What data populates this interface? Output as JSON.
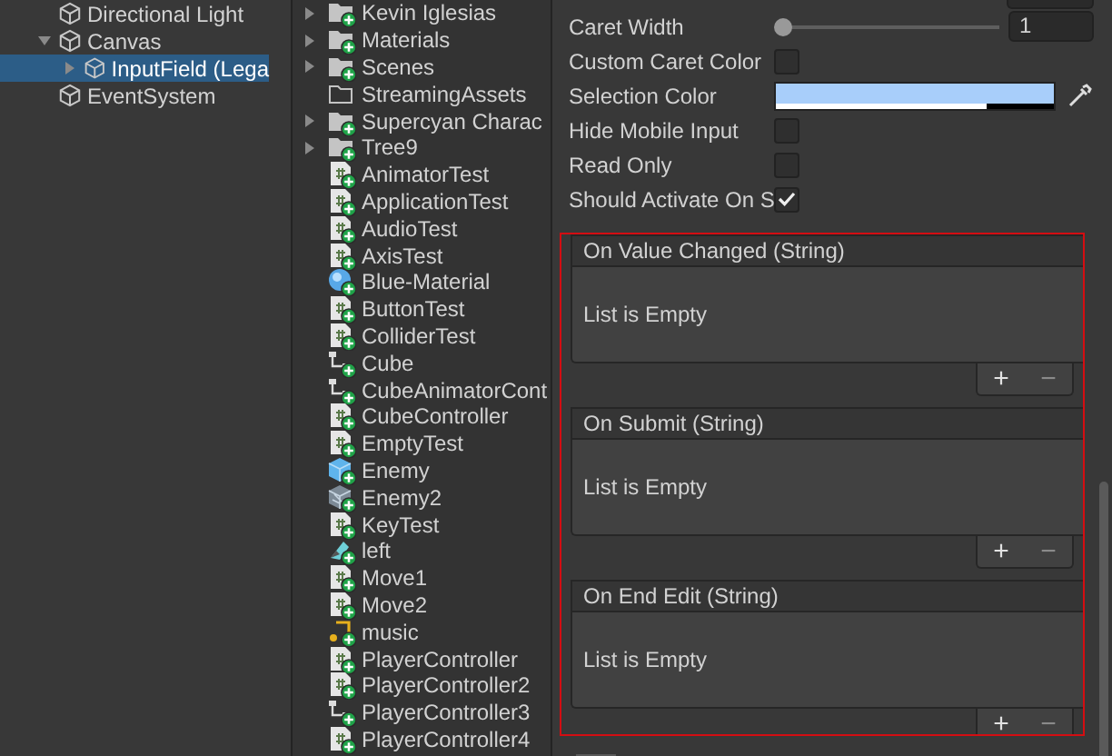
{
  "hierarchy": {
    "items": [
      {
        "label": "Directional Light",
        "selected": false
      },
      {
        "label": "Canvas",
        "selected": false,
        "expanded": true,
        "children": [
          {
            "label": "InputField (Lega",
            "selected": true,
            "expanded": false
          }
        ]
      },
      {
        "label": "EventSystem",
        "selected": false
      }
    ]
  },
  "project": {
    "items": [
      {
        "label": "Kevin Iglesias",
        "kind": "folder",
        "expanded": false,
        "added": true
      },
      {
        "label": "Materials",
        "kind": "folder",
        "expanded": false,
        "added": true
      },
      {
        "label": "Scenes",
        "kind": "folder",
        "expanded": false,
        "added": true
      },
      {
        "label": "StreamingAssets",
        "kind": "empty-folder",
        "added": false
      },
      {
        "label": "Supercyan Charac",
        "kind": "folder",
        "expanded": false,
        "added": true
      },
      {
        "label": "Tree9",
        "kind": "folder",
        "expanded": false,
        "added": true
      },
      {
        "label": "AnimatorTest",
        "kind": "script",
        "added": true
      },
      {
        "label": "ApplicationTest",
        "kind": "script",
        "added": true
      },
      {
        "label": "AudioTest",
        "kind": "script",
        "added": true
      },
      {
        "label": "AxisTest",
        "kind": "script",
        "added": true
      },
      {
        "label": "Blue-Material",
        "kind": "material",
        "added": true
      },
      {
        "label": "ButtonTest",
        "kind": "script",
        "added": true
      },
      {
        "label": "ColliderTest",
        "kind": "script",
        "added": true
      },
      {
        "label": "Cube",
        "kind": "animator",
        "added": true
      },
      {
        "label": "CubeAnimatorCont",
        "kind": "animator",
        "added": true
      },
      {
        "label": "CubeController",
        "kind": "script",
        "added": true
      },
      {
        "label": "EmptyTest",
        "kind": "script",
        "added": true
      },
      {
        "label": "Enemy",
        "kind": "prefab",
        "added": true
      },
      {
        "label": "Enemy2",
        "kind": "model",
        "added": true
      },
      {
        "label": "KeyTest",
        "kind": "script",
        "added": true
      },
      {
        "label": "left",
        "kind": "sprite",
        "added": true
      },
      {
        "label": "Move1",
        "kind": "script",
        "added": true
      },
      {
        "label": "Move2",
        "kind": "script",
        "added": true
      },
      {
        "label": "music",
        "kind": "audio",
        "added": true
      },
      {
        "label": "PlayerController",
        "kind": "script",
        "added": true
      },
      {
        "label": "PlayerController2",
        "kind": "script",
        "added": true
      },
      {
        "label": "PlayerController3",
        "kind": "animator",
        "added": true
      },
      {
        "label": "PlayerController4",
        "kind": "script",
        "added": true
      }
    ]
  },
  "inspector": {
    "fields": [
      {
        "kind": "slider",
        "label": "Caret Width",
        "level": 0,
        "value": "1"
      },
      {
        "kind": "checkbox",
        "label": "Custom Caret Color",
        "checked": false
      },
      {
        "kind": "color",
        "label": "Selection Color",
        "color": "#a8cefa",
        "level": 0.76
      },
      {
        "kind": "checkbox",
        "label": "Hide Mobile Input",
        "checked": false
      },
      {
        "kind": "checkbox",
        "label": "Read Only",
        "checked": false
      },
      {
        "kind": "checkbox",
        "label": "Should Activate On S",
        "checked": true
      }
    ],
    "events": [
      {
        "title": "On Value Changed (String)",
        "empty_text": "List is Empty",
        "add": "+",
        "remove": "−"
      },
      {
        "title": "On Submit (String)",
        "empty_text": "List is Empty",
        "add": "+",
        "remove": "−"
      },
      {
        "title": "On End Edit (String)",
        "empty_text": "List is Empty",
        "add": "+",
        "remove": "−"
      }
    ]
  }
}
